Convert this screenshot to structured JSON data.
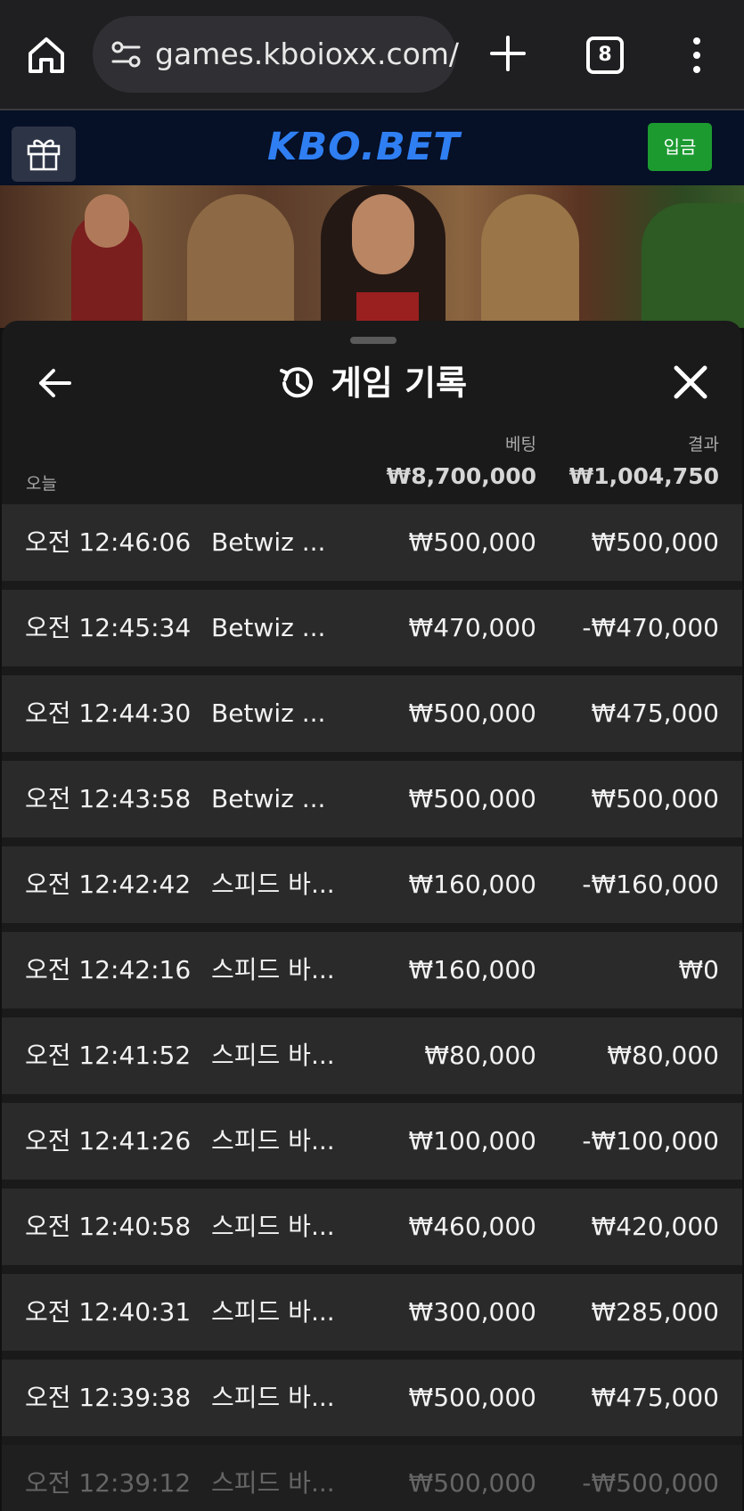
{
  "browser": {
    "url": "games.kboioxx.com/",
    "tab_count": "8",
    "icons": [
      "home-icon",
      "site-settings-icon",
      "plus-icon",
      "tabs-icon",
      "more-vert-icon"
    ]
  },
  "site": {
    "logo": "KBO.BET",
    "deposit_label": "입금",
    "colors": {
      "logo": "#2f7ff3",
      "deposit": "#1c9a30",
      "header_bg": "#061026"
    }
  },
  "history": {
    "title": "게임 기록",
    "bet_label": "베팅",
    "result_label": "결과",
    "today_label": "오늘",
    "bet_total": "₩8,700,000",
    "result_total": "₩1,004,750",
    "rows": [
      {
        "time": "오전 12:46:06",
        "game": "Betwiz ...",
        "bet": "₩500,000",
        "result": "₩500,000"
      },
      {
        "time": "오전 12:45:34",
        "game": "Betwiz ...",
        "bet": "₩470,000",
        "result": "-₩470,000"
      },
      {
        "time": "오전 12:44:30",
        "game": "Betwiz ...",
        "bet": "₩500,000",
        "result": "₩475,000"
      },
      {
        "time": "오전 12:43:58",
        "game": "Betwiz ...",
        "bet": "₩500,000",
        "result": "₩500,000"
      },
      {
        "time": "오전 12:42:42",
        "game": "스피드 바...",
        "bet": "₩160,000",
        "result": "-₩160,000"
      },
      {
        "time": "오전 12:42:16",
        "game": "스피드 바...",
        "bet": "₩160,000",
        "result": "₩0"
      },
      {
        "time": "오전 12:41:52",
        "game": "스피드 바...",
        "bet": "₩80,000",
        "result": "₩80,000"
      },
      {
        "time": "오전 12:41:26",
        "game": "스피드 바...",
        "bet": "₩100,000",
        "result": "-₩100,000"
      },
      {
        "time": "오전 12:40:58",
        "game": "스피드 바...",
        "bet": "₩460,000",
        "result": "₩420,000"
      },
      {
        "time": "오전 12:40:31",
        "game": "스피드 바...",
        "bet": "₩300,000",
        "result": "₩285,000"
      },
      {
        "time": "오전 12:39:38",
        "game": "스피드 바...",
        "bet": "₩500,000",
        "result": "₩475,000"
      },
      {
        "time": "오전 12:39:12",
        "game": "스피드 바...",
        "bet": "₩500,000",
        "result": "-₩500,000"
      }
    ]
  }
}
